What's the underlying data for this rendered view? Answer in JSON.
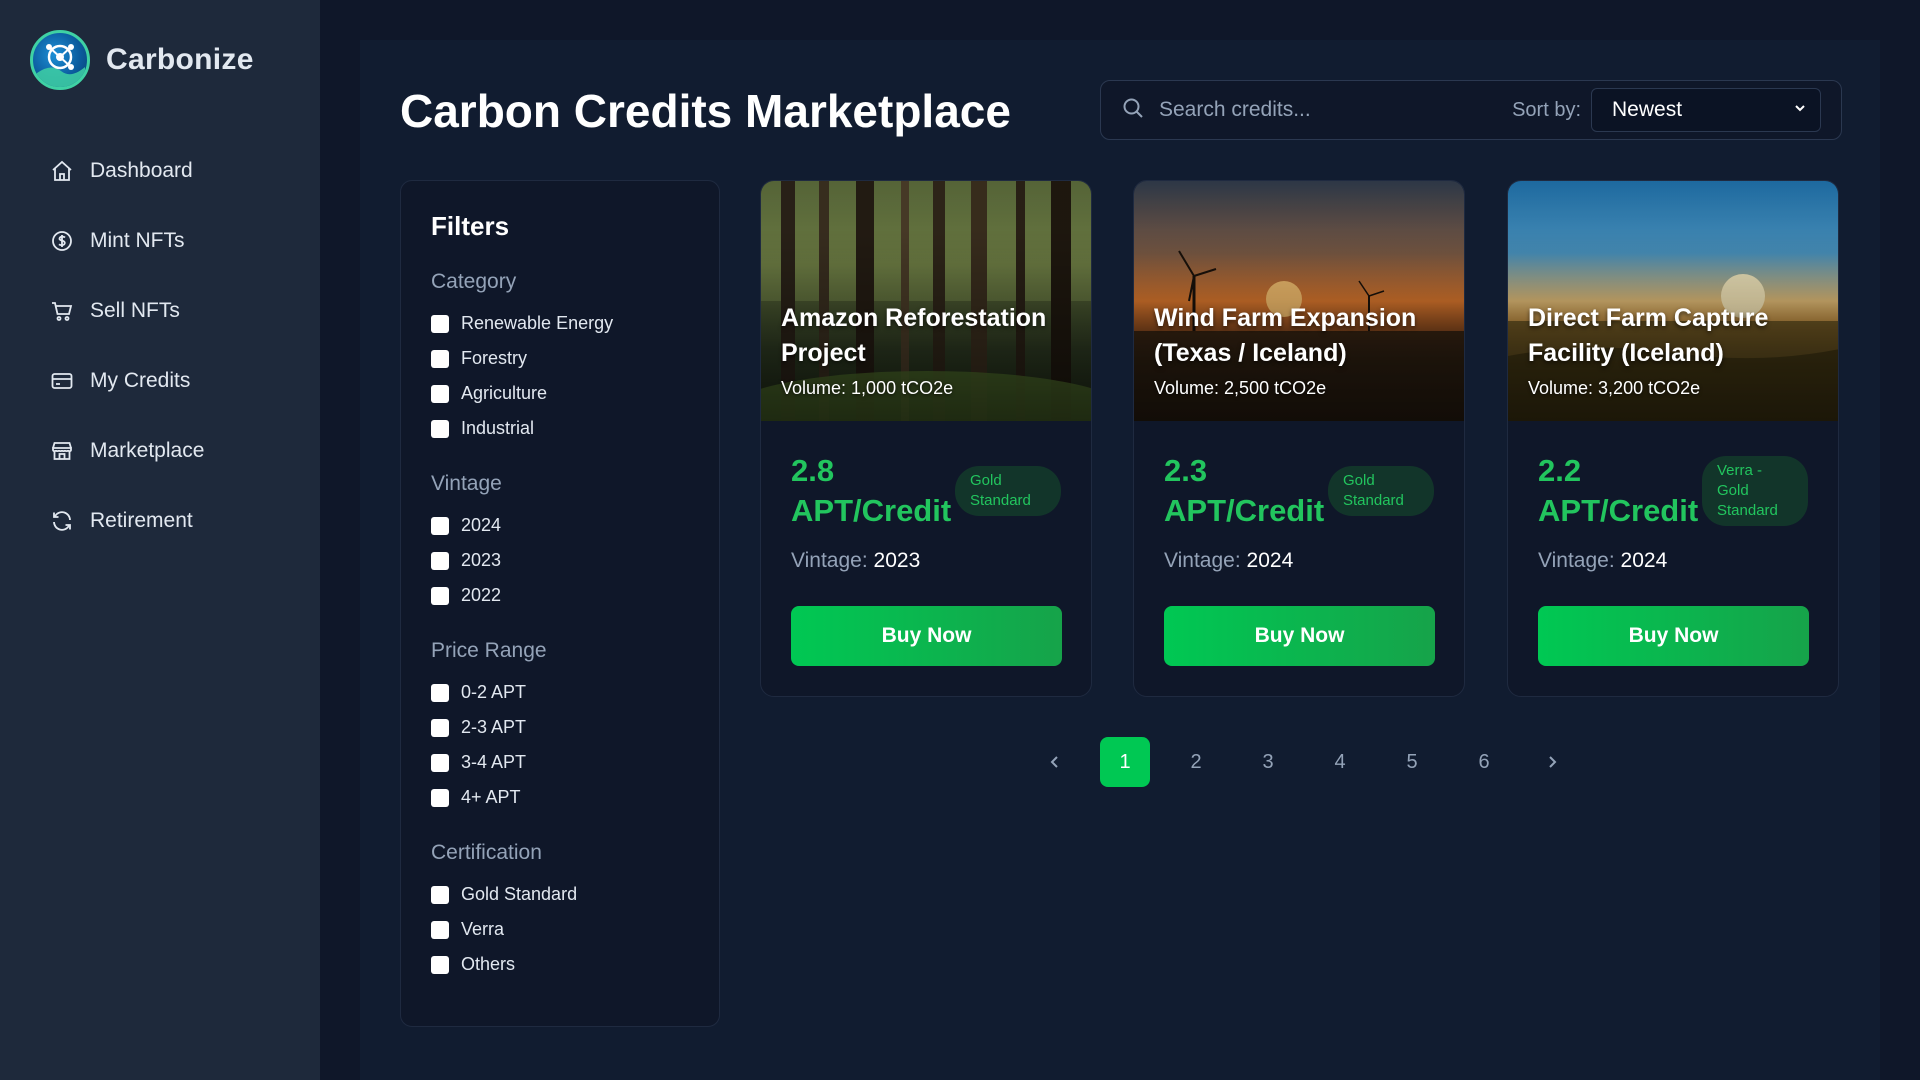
{
  "app": {
    "name": "Carbonize"
  },
  "nav": {
    "items": [
      {
        "label": "Dashboard",
        "icon": "home-icon"
      },
      {
        "label": "Mint NFTs",
        "icon": "dollar-circle-icon"
      },
      {
        "label": "Sell NFTs",
        "icon": "cart-icon"
      },
      {
        "label": "My Credits",
        "icon": "credit-card-icon"
      },
      {
        "label": "Marketplace",
        "icon": "store-icon"
      },
      {
        "label": "Retirement",
        "icon": "refresh-icon"
      }
    ]
  },
  "header": {
    "title": "Carbon Credits Marketplace",
    "search_placeholder": "Search credits...",
    "sort_label": "Sort by:",
    "sort_value": "Newest"
  },
  "filters": {
    "title": "Filters",
    "groups": [
      {
        "title": "Category",
        "options": [
          "Renewable Energy",
          "Forestry",
          "Agriculture",
          "Industrial"
        ]
      },
      {
        "title": "Vintage",
        "options": [
          "2024",
          "2023",
          "2022"
        ]
      },
      {
        "title": "Price Range",
        "options": [
          "0-2 APT",
          "2-3 APT",
          "3-4 APT",
          "4+ APT"
        ]
      },
      {
        "title": "Certification",
        "options": [
          "Gold Standard",
          "Verra",
          "Others"
        ]
      }
    ]
  },
  "cards": [
    {
      "title": "Amazon Reforestation Project",
      "volume": "Volume: 1,000 tCO2e",
      "price": "2.8 APT/Credit",
      "badge": "Gold Standard",
      "vintage_label": "Vintage:",
      "vintage": "2023",
      "button": "Buy Now",
      "image": "forest"
    },
    {
      "title": "Wind Farm Expansion (Texas / Iceland)",
      "volume": "Volume: 2,500 tCO2e",
      "price": "2.3 APT/Credit",
      "badge": "Gold Standard",
      "vintage_label": "Vintage:",
      "vintage": "2024",
      "button": "Buy Now",
      "image": "wind-farm-sunset"
    },
    {
      "title": "Direct Farm Capture Facility (Iceland)",
      "volume": "Volume: 3,200 tCO2e",
      "price": "2.2 APT/Credit",
      "badge": "Verra - Gold Standard",
      "vintage_label": "Vintage:",
      "vintage": "2024",
      "button": "Buy Now",
      "image": "field-sunrise"
    }
  ],
  "pagination": {
    "prev": "‹",
    "pages": [
      "1",
      "2",
      "3",
      "4",
      "5",
      "6"
    ],
    "current": "1",
    "next": "›"
  },
  "colors": {
    "accent": "#22c55e",
    "button": "#00c853",
    "sidebar": "#1e293b",
    "background": "#0f1729"
  }
}
